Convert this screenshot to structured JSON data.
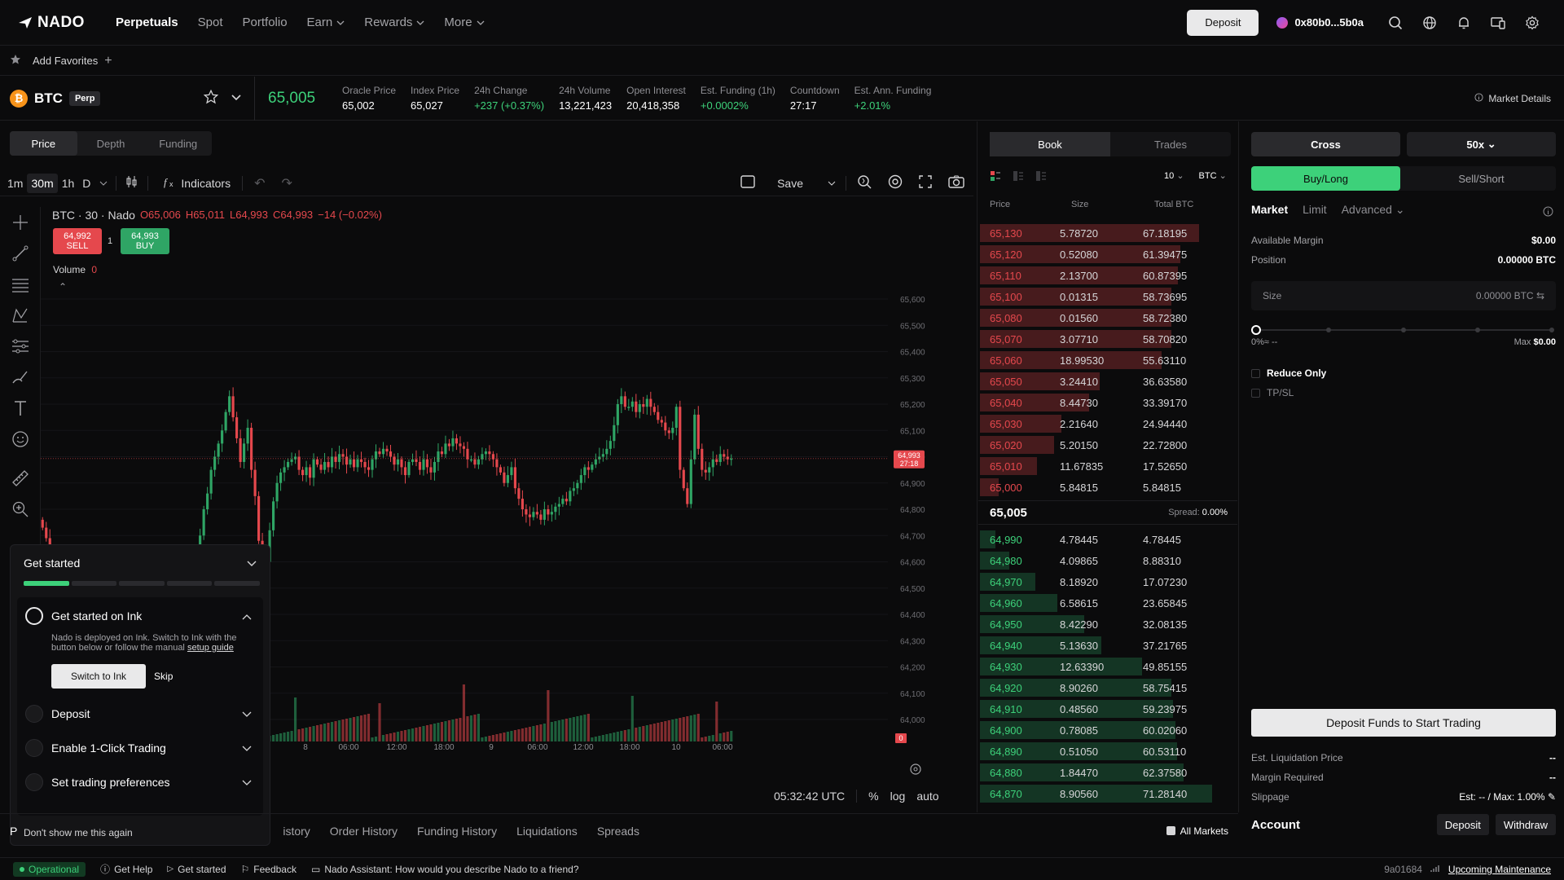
{
  "nav": {
    "logo": "NADO",
    "items": [
      {
        "label": "Perpetuals",
        "active": true,
        "dropdown": false
      },
      {
        "label": "Spot",
        "active": false,
        "dropdown": false
      },
      {
        "label": "Portfolio",
        "active": false,
        "dropdown": false
      },
      {
        "label": "Earn",
        "active": false,
        "dropdown": true
      },
      {
        "label": "Rewards",
        "active": false,
        "dropdown": true
      },
      {
        "label": "More",
        "active": false,
        "dropdown": true
      }
    ],
    "deposit_label": "Deposit",
    "wallet": "0x80b0...5b0a",
    "icons": [
      "search-icon",
      "globe-icon",
      "bell-icon",
      "devices-icon",
      "gear-icon"
    ]
  },
  "favorites": {
    "label": "Add Favorites"
  },
  "market": {
    "symbol": "BTC",
    "badge": "Perp",
    "last_price": "65,005",
    "stats": [
      {
        "label": "Oracle Price",
        "value": "65,002",
        "green": false
      },
      {
        "label": "Index Price",
        "value": "65,027",
        "green": false
      },
      {
        "label": "24h Change",
        "value": "+237 (+0.37%)",
        "green": true
      },
      {
        "label": "24h Volume",
        "value": "13,221,423",
        "green": false
      },
      {
        "label": "Open Interest",
        "value": "20,418,358",
        "green": false
      },
      {
        "label": "Est. Funding (1h)",
        "value": "+0.0002%",
        "green": true
      },
      {
        "label": "Countdown",
        "value": "27:17",
        "green": false
      },
      {
        "label": "Est. Ann. Funding",
        "value": "+2.01%",
        "green": true
      }
    ],
    "details_label": "Market Details"
  },
  "chart_tabs": [
    "Price",
    "Depth",
    "Funding"
  ],
  "chart_toolbar": {
    "intervals": [
      "1m",
      "30m",
      "1h",
      "D"
    ],
    "selected_interval": "30m",
    "indicators_label": "Indicators",
    "save_label": "Save"
  },
  "chart_header": {
    "title": "BTC · 30 · Nado",
    "o": "O65,006",
    "h": "H65,011",
    "l": "L64,993",
    "c": "C64,993",
    "chg": "−14 (−0.02%)",
    "sell_price": "64,992",
    "sell_label": "SELL",
    "spread": "1",
    "buy_price": "64,993",
    "buy_label": "BUY",
    "volume_label": "Volume",
    "volume_value": "0"
  },
  "chart_data": {
    "type": "candlestick",
    "y_ticks": [
      "65,600",
      "65,500",
      "65,400",
      "65,300",
      "65,200",
      "65,100",
      "65,000",
      "64,900",
      "64,800",
      "64,700",
      "64,600",
      "64,500",
      "64,400",
      "64,300",
      "64,200",
      "64,100",
      "64,000"
    ],
    "ylim": [
      64000,
      65600
    ],
    "x_ticks": [
      "18:00",
      "8",
      "06:00",
      "12:00",
      "18:00",
      "9",
      "06:00",
      "12:00",
      "18:00",
      "10",
      "06:00"
    ],
    "last_price_tag": "64,993",
    "last_price_countdown": "27:18",
    "volume_tag": "0",
    "bull_color": "#2fa565",
    "bear_color": "#e5484d"
  },
  "chart_footer": {
    "time": "05:32:42 UTC",
    "pct": "%",
    "log": "log",
    "auto": "auto"
  },
  "get_started": {
    "title": "Get started",
    "progress_total": 5,
    "progress_done": 1,
    "step1_title": "Get started on Ink",
    "step1_desc": "Nado is deployed on Ink. Switch to Ink with the button below or follow the manual",
    "step1_link": "setup guide",
    "switch_label": "Switch to Ink",
    "skip_label": "Skip",
    "steps": [
      "Deposit",
      "Enable 1-Click Trading",
      "Set trading preferences"
    ],
    "dont_show": "Don't show me this again"
  },
  "bottom_tabs": [
    "istory",
    "Order History",
    "Funding History",
    "Liquidations",
    "Spreads"
  ],
  "bottom_partial": "P",
  "all_markets": "All Markets",
  "status": {
    "operational": "Operational",
    "items": [
      "Get Help",
      "Get started",
      "Feedback",
      "Nado Assistant: How would you describe Nado to a friend?"
    ],
    "version": "9a01684",
    "maintenance": "Upcoming Maintenance"
  },
  "book": {
    "tabs": [
      "Book",
      "Trades"
    ],
    "depth_select": "10",
    "unit_select": "BTC",
    "headers": [
      "Price",
      "Size",
      "Total BTC"
    ],
    "asks": [
      [
        "65,130",
        "5.78720",
        "67.18195"
      ],
      [
        "65,120",
        "0.52080",
        "61.39475"
      ],
      [
        "65,110",
        "2.13700",
        "60.87395"
      ],
      [
        "65,100",
        "0.01315",
        "58.73695"
      ],
      [
        "65,080",
        "0.01560",
        "58.72380"
      ],
      [
        "65,070",
        "3.07710",
        "58.70820"
      ],
      [
        "65,060",
        "18.99530",
        "55.63110"
      ],
      [
        "65,050",
        "3.24410",
        "36.63580"
      ],
      [
        "65,040",
        "8.44730",
        "33.39170"
      ],
      [
        "65,030",
        "2.21640",
        "24.94440"
      ],
      [
        "65,020",
        "5.20150",
        "22.72800"
      ],
      [
        "65,010",
        "11.67835",
        "17.52650"
      ],
      [
        "65,000",
        "5.84815",
        "5.84815"
      ]
    ],
    "mid_price": "65,005",
    "spread_label": "Spread:",
    "spread_value": "0.00%",
    "bids": [
      [
        "64,990",
        "4.78445",
        "4.78445"
      ],
      [
        "64,980",
        "4.09865",
        "8.88310"
      ],
      [
        "64,970",
        "8.18920",
        "17.07230"
      ],
      [
        "64,960",
        "6.58615",
        "23.65845"
      ],
      [
        "64,950",
        "8.42290",
        "32.08135"
      ],
      [
        "64,940",
        "5.13630",
        "37.21765"
      ],
      [
        "64,930",
        "12.63390",
        "49.85155"
      ],
      [
        "64,920",
        "8.90260",
        "58.75415"
      ],
      [
        "64,910",
        "0.48560",
        "59.23975"
      ],
      [
        "64,900",
        "0.78085",
        "60.02060"
      ],
      [
        "64,890",
        "0.51050",
        "60.53110"
      ],
      [
        "64,880",
        "1.84470",
        "62.37580"
      ],
      [
        "64,870",
        "8.90560",
        "71.28140"
      ]
    ]
  },
  "order": {
    "margin_mode": "Cross",
    "leverage": "50x",
    "sides": [
      "Buy/Long",
      "Sell/Short"
    ],
    "types": [
      "Market",
      "Limit",
      "Advanced"
    ],
    "available_margin_label": "Available Margin",
    "available_margin": "$0.00",
    "position_label": "Position",
    "position": "0.00000 BTC",
    "size_label": "Size",
    "size_value": "0.00000",
    "size_unit": "BTC",
    "slider_min": "0%≈ --",
    "slider_max_label": "Max",
    "slider_max": "$0.00",
    "reduce_only": "Reduce Only",
    "tpsl": "TP/SL",
    "cta": "Deposit Funds to Start Trading",
    "details": [
      {
        "label": "Est. Liquidation Price",
        "value": "--"
      },
      {
        "label": "Margin Required",
        "value": "--"
      },
      {
        "label": "Slippage",
        "value": "Est: -- / Max: 1.00%"
      }
    ],
    "account_label": "Account",
    "deposit_label": "Deposit",
    "withdraw_label": "Withdraw"
  }
}
